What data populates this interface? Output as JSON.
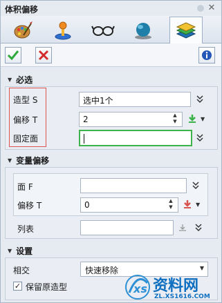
{
  "window": {
    "title": "体积偏移"
  },
  "tabs": [
    {
      "name": "tab-palette",
      "icon": "palette-icon"
    },
    {
      "name": "tab-joystick",
      "icon": "joystick-icon"
    },
    {
      "name": "tab-glasses",
      "icon": "glasses-icon"
    },
    {
      "name": "tab-sphere",
      "icon": "sphere-icon"
    },
    {
      "name": "tab-layers",
      "icon": "layers-icon",
      "active": true
    }
  ],
  "toolbar": {
    "ok_icon": "check-icon",
    "cancel_icon": "x-icon",
    "info_icon": "info-icon"
  },
  "required": {
    "header": "必选",
    "shape_label": "造型 S",
    "shape_value": "选中1个",
    "offset_label": "偏移 T",
    "offset_value": "2",
    "fixed_face_label": "固定面",
    "fixed_face_value": ""
  },
  "variable": {
    "header": "变量偏移",
    "face_label": "面 F",
    "face_value": "",
    "offset_label": "偏移 T",
    "offset_value": "0",
    "list_label": "列表",
    "list_value": ""
  },
  "settings": {
    "header": "设置",
    "intersect_label": "相交",
    "intersect_value": "快速移除",
    "keep_original_label": "保留原造型",
    "keep_original_checked": true
  },
  "watermark": {
    "brand": "资料网",
    "url": "ZL.XS1616.COM"
  },
  "colors": {
    "accent_green": "#3bb24a",
    "highlight_red": "#d9534f"
  }
}
